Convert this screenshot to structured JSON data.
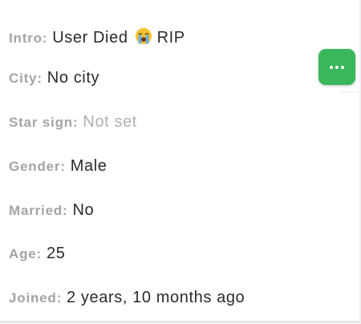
{
  "profile": {
    "intro": {
      "label": "Intro:",
      "value": "User Died",
      "emoji": "loudly-crying-face",
      "suffix": "RIP"
    },
    "city": {
      "label": "City:",
      "value": "No city"
    },
    "star": {
      "label": "Star sign:",
      "value": "Not set"
    },
    "gender": {
      "label": "Gender:",
      "value": "Male"
    },
    "married": {
      "label": "Married:",
      "value": "No"
    },
    "age": {
      "label": "Age:",
      "value": "25"
    },
    "joined": {
      "label": "Joined:",
      "value": "2 years, 10 months ago"
    }
  },
  "actions": {
    "more_icon": "more-horizontal-icon"
  },
  "colors": {
    "label": "#a4a4a4",
    "value": "#2a2a2a",
    "muted": "#b0b0b0",
    "accent": "#39b75a"
  }
}
